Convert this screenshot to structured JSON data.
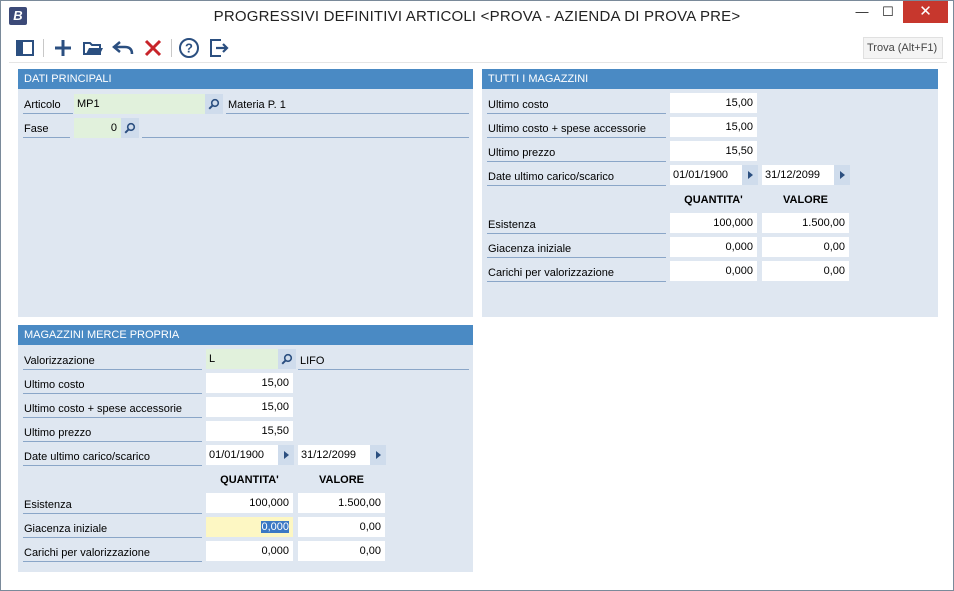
{
  "app": {
    "icon_letter": "B",
    "title": "PROGRESSIVI DEFINITIVI ARTICOLI <PROVA - AZIENDA DI PROVA PRE>"
  },
  "window_controls": {
    "minimize": "—",
    "maximize": "☐",
    "close": "✕"
  },
  "toolbar": {
    "icons": [
      "sidebar-toggle-icon",
      "add-icon",
      "open-folder-icon",
      "undo-icon",
      "delete-icon",
      "help-icon",
      "exit-icon"
    ],
    "search_label": "Trova (Alt+F1)"
  },
  "colors": {
    "panel_header": "#4a8ac4",
    "panel_bg": "#dfe7f1",
    "key_field_bg": "#e1f1dc",
    "focused_field_bg": "#fdf7c3",
    "close_button": "#c7372d"
  },
  "dati_principali": {
    "header": "DATI PRINCIPALI",
    "articolo_label": "Articolo",
    "articolo_value": "MP1",
    "articolo_desc": "Materia P. 1",
    "fase_label": "Fase",
    "fase_value": "0"
  },
  "tutti_magazzini": {
    "header": "TUTTI I MAGAZZINI",
    "ultimo_costo_label": "Ultimo costo",
    "ultimo_costo_value": "15,00",
    "ultimo_costo_spese_label": "Ultimo costo + spese accessorie",
    "ultimo_costo_spese_value": "15,00",
    "ultimo_prezzo_label": "Ultimo prezzo",
    "ultimo_prezzo_value": "15,50",
    "date_label": "Date ultimo carico/scarico",
    "date_carico": "01/01/1900",
    "date_scarico": "31/12/2099",
    "col_quantita": "QUANTITA'",
    "col_valore": "VALORE",
    "rows": [
      {
        "label": "Esistenza",
        "quantita": "100,000",
        "valore": "1.500,00"
      },
      {
        "label": "Giacenza iniziale",
        "quantita": "0,000",
        "valore": "0,00"
      },
      {
        "label": "Carichi per valorizzazione",
        "quantita": "0,000",
        "valore": "0,00"
      }
    ]
  },
  "magazzini_merce_propria": {
    "header": "MAGAZZINI MERCE PROPRIA",
    "valorizzazione_label": "Valorizzazione",
    "valorizzazione_value": "L",
    "valorizzazione_desc": "LIFO",
    "ultimo_costo_label": "Ultimo costo",
    "ultimo_costo_value": "15,00",
    "ultimo_costo_spese_label": "Ultimo costo + spese accessorie",
    "ultimo_costo_spese_value": "15,00",
    "ultimo_prezzo_label": "Ultimo prezzo",
    "ultimo_prezzo_value": "15,50",
    "date_label": "Date ultimo carico/scarico",
    "date_carico": "01/01/1900",
    "date_scarico": "31/12/2099",
    "col_quantita": "QUANTITA'",
    "col_valore": "VALORE",
    "rows": [
      {
        "label": "Esistenza",
        "quantita": "100,000",
        "valore": "1.500,00"
      },
      {
        "label": "Giacenza iniziale",
        "quantita": "0,000",
        "valore": "0,00"
      },
      {
        "label": "Carichi per valorizzazione",
        "quantita": "0,000",
        "valore": "0,00"
      }
    ]
  }
}
